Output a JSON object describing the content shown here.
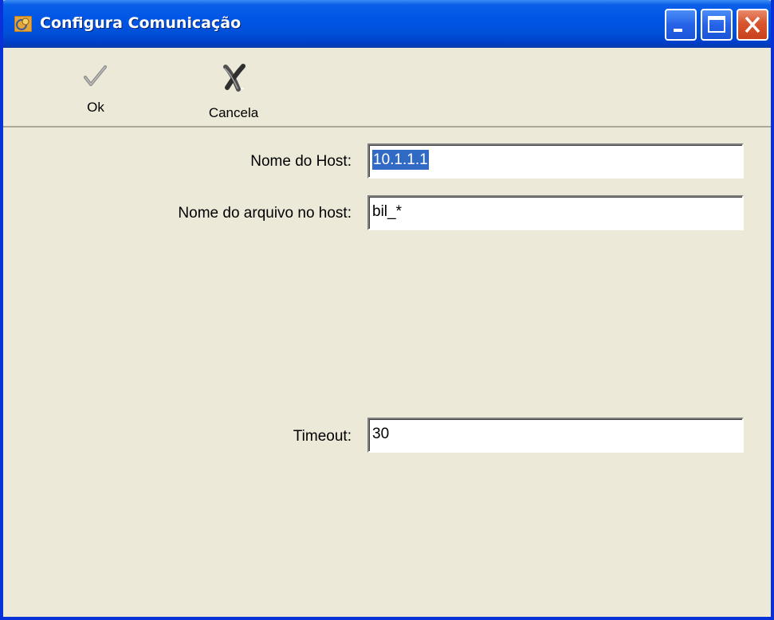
{
  "window": {
    "title": "Configura Comunicação"
  },
  "titlebar_buttons": {
    "minimize": "minimize-icon",
    "maximize": "maximize-icon",
    "close": "close-icon"
  },
  "toolbar": {
    "ok_label": "Ok",
    "ok_icon": "checkmark-icon",
    "cancel_label": "Cancela",
    "cancel_icon": "x-cancel-icon"
  },
  "form": {
    "host_label": "Nome do Host:",
    "host_value": "10.1.1.1",
    "file_label": "Nome do arquivo no host:",
    "file_value": "bil_*",
    "timeout_label": "Timeout:",
    "timeout_value": "30"
  },
  "colors": {
    "titlebar": "#0055e5",
    "window_bg": "#ece9d8",
    "selection": "#316ac5",
    "close_button": "#d7562f"
  }
}
